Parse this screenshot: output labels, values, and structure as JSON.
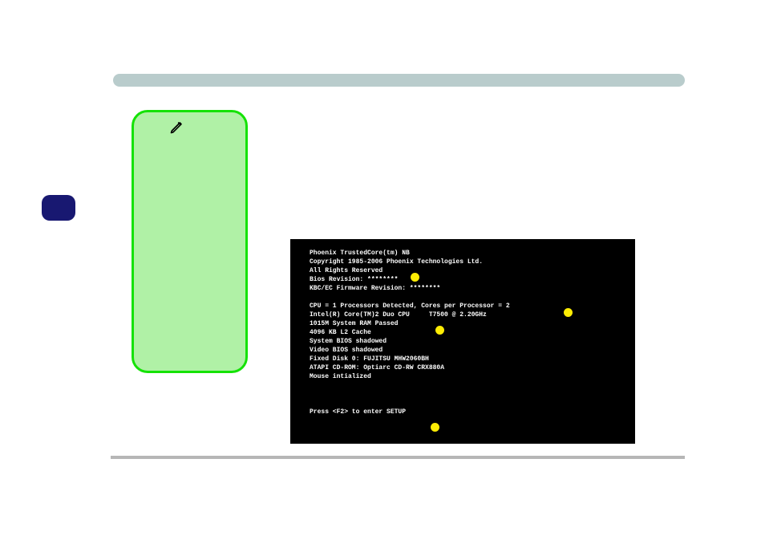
{
  "bios": {
    "intro1": "Phoenix TrustedCore(tm) NB",
    "intro2": "Copyright 1985-2006 Phoenix Technologies Ltd.",
    "intro3": "All Rights Reserved",
    "biosrev": "Bios Revision: ********",
    "kbc": "KBC/EC Firmware Revision: ********",
    "cpu1": "CPU = 1 Processors Detected, Cores per Processor = 2",
    "cpu2": "Intel(R) Core(TM)2 Duo CPU     T7500 @ 2.20GHz",
    "ram": "1015M System RAM Passed",
    "l2": "4096 KB L2 Cache",
    "sbios": "System BIOS shadowed",
    "vbios": "Video BIOS shadowed",
    "disk": "Fixed Disk 0: FUJITSU MHW2060BH",
    "atapi": "ATAPI CD-ROM: Optiarc CD-RW CRX880A",
    "mouse": "Mouse intialized",
    "prompt": "Press <F2> to enter SETUP"
  }
}
